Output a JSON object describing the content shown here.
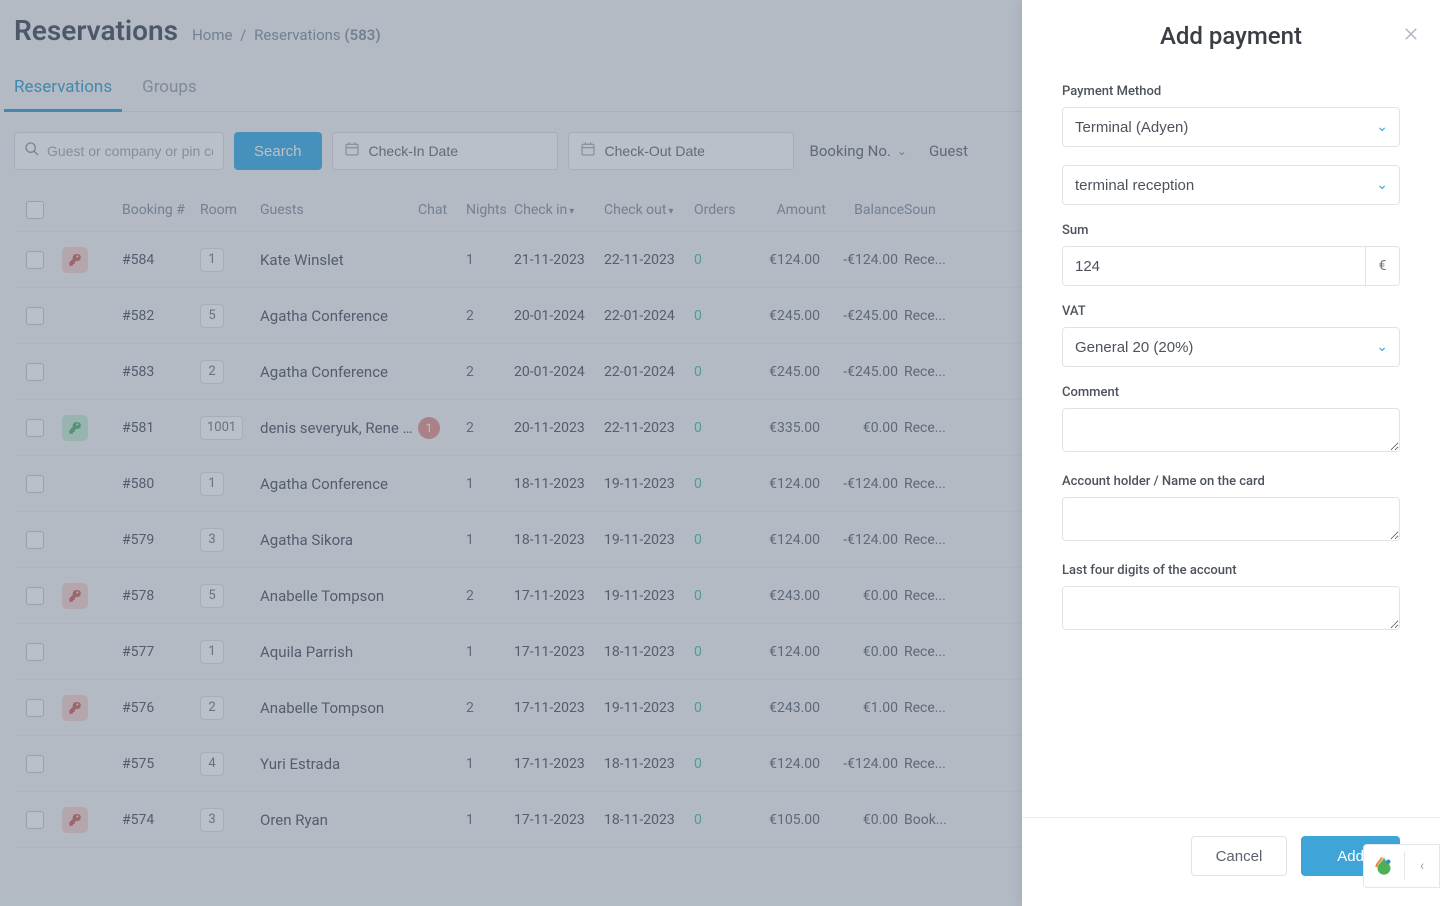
{
  "header": {
    "title": "Reservations",
    "breadcrumb_home": "Home",
    "breadcrumb_current": "Reservations",
    "breadcrumb_count": "(583)"
  },
  "tabs": {
    "reservations": "Reservations",
    "groups": "Groups"
  },
  "filters": {
    "search_placeholder": "Guest or company or pin co...",
    "search_button": "Search",
    "checkin_placeholder": "Check-In Date",
    "checkout_placeholder": "Check-Out Date",
    "booking_no": "Booking No.",
    "guest": "Guest"
  },
  "table": {
    "headers": {
      "booking": "Booking #",
      "room": "Room",
      "guests": "Guests",
      "chat": "Chat",
      "nights": "Nights",
      "checkin": "Check in",
      "checkout": "Check out",
      "orders": "Orders",
      "amount": "Amount",
      "balance": "Balance",
      "source": "Soun"
    },
    "rows": [
      {
        "key": "red",
        "booking": "#584",
        "room": "1",
        "guests": "Kate Winslet",
        "chat": "",
        "nights": "1",
        "checkin": "21-11-2023",
        "checkout": "22-11-2023",
        "orders": "0",
        "amount": "€124.00",
        "balance": "-€124.00",
        "source": "Rece..."
      },
      {
        "key": "",
        "booking": "#582",
        "room": "5",
        "guests": "Agatha Conference",
        "chat": "",
        "nights": "2",
        "checkin": "20-01-2024",
        "checkout": "22-01-2024",
        "orders": "0",
        "amount": "€245.00",
        "balance": "-€245.00",
        "source": "Rece..."
      },
      {
        "key": "",
        "booking": "#583",
        "room": "2",
        "guests": "Agatha Conference",
        "chat": "",
        "nights": "2",
        "checkin": "20-01-2024",
        "checkout": "22-01-2024",
        "orders": "0",
        "amount": "€245.00",
        "balance": "-€245.00",
        "source": "Rece..."
      },
      {
        "key": "green",
        "booking": "#581",
        "room": "1001",
        "guests": "denis severyuk, Rene …",
        "chat": "1",
        "nights": "2",
        "checkin": "20-11-2023",
        "checkout": "22-11-2023",
        "orders": "0",
        "amount": "€335.00",
        "balance": "€0.00",
        "source": "Rece..."
      },
      {
        "key": "",
        "booking": "#580",
        "room": "1",
        "guests": "Agatha Conference",
        "chat": "",
        "nights": "1",
        "checkin": "18-11-2023",
        "checkout": "19-11-2023",
        "orders": "0",
        "amount": "€124.00",
        "balance": "-€124.00",
        "source": "Rece..."
      },
      {
        "key": "",
        "booking": "#579",
        "room": "3",
        "guests": "Agatha Sikora",
        "chat": "",
        "nights": "1",
        "checkin": "18-11-2023",
        "checkout": "19-11-2023",
        "orders": "0",
        "amount": "€124.00",
        "balance": "-€124.00",
        "source": "Rece..."
      },
      {
        "key": "red",
        "booking": "#578",
        "room": "5",
        "guests": "Anabelle Tompson",
        "chat": "",
        "nights": "2",
        "checkin": "17-11-2023",
        "checkout": "19-11-2023",
        "orders": "0",
        "amount": "€243.00",
        "balance": "€0.00",
        "source": "Rece..."
      },
      {
        "key": "",
        "booking": "#577",
        "room": "1",
        "guests": "Aquila Parrish",
        "chat": "",
        "nights": "1",
        "checkin": "17-11-2023",
        "checkout": "18-11-2023",
        "orders": "0",
        "amount": "€124.00",
        "balance": "€0.00",
        "source": "Rece..."
      },
      {
        "key": "red",
        "booking": "#576",
        "room": "2",
        "guests": "Anabelle Tompson",
        "chat": "",
        "nights": "2",
        "checkin": "17-11-2023",
        "checkout": "19-11-2023",
        "orders": "0",
        "amount": "€243.00",
        "balance": "€1.00",
        "source": "Rece..."
      },
      {
        "key": "",
        "booking": "#575",
        "room": "4",
        "guests": "Yuri Estrada",
        "chat": "",
        "nights": "1",
        "checkin": "17-11-2023",
        "checkout": "18-11-2023",
        "orders": "0",
        "amount": "€124.00",
        "balance": "-€124.00",
        "source": "Rece..."
      },
      {
        "key": "red",
        "booking": "#574",
        "room": "3",
        "guests": "Oren Ryan",
        "chat": "",
        "nights": "1",
        "checkin": "17-11-2023",
        "checkout": "18-11-2023",
        "orders": "0",
        "amount": "€105.00",
        "balance": "€0.00",
        "source": "Book..."
      }
    ]
  },
  "panel": {
    "title": "Add payment",
    "payment_method_label": "Payment Method",
    "payment_method_value": "Terminal (Adyen)",
    "terminal_value": "terminal reception",
    "sum_label": "Sum",
    "sum_value": "124",
    "currency": "€",
    "vat_label": "VAT",
    "vat_value": "General 20 (20%)",
    "comment_label": "Comment",
    "holder_label": "Account holder / Name on the card",
    "last4_label": "Last four digits of the account",
    "cancel": "Cancel",
    "add": "Add"
  }
}
